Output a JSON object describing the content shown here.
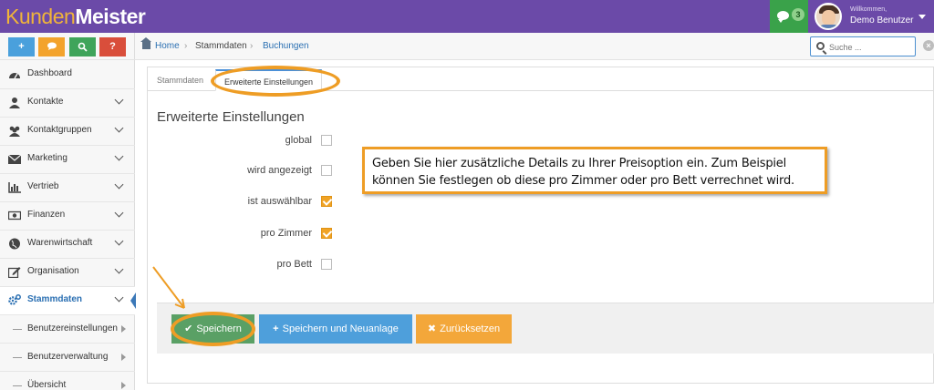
{
  "app": {
    "logo_part1": "Kunden",
    "logo_part2": "Meister",
    "message_count": "3",
    "welcome": "Willkommen,",
    "user": "Demo Benutzer"
  },
  "quick_buttons": [
    "+",
    "chat",
    "search",
    "?"
  ],
  "sidebar": {
    "items": [
      {
        "label": "Dashboard",
        "icon": "dashboard-icon"
      },
      {
        "label": "Kontakte",
        "icon": "user-icon"
      },
      {
        "label": "Kontaktgruppen",
        "icon": "group-icon"
      },
      {
        "label": "Marketing",
        "icon": "envelope-icon"
      },
      {
        "label": "Vertrieb",
        "icon": "bar-chart-icon"
      },
      {
        "label": "Finanzen",
        "icon": "money-icon"
      },
      {
        "label": "Warenwirtschaft",
        "icon": "globe-icon"
      },
      {
        "label": "Organisation",
        "icon": "edit-icon"
      },
      {
        "label": "Stammdaten",
        "icon": "gears-icon"
      }
    ],
    "subitems": [
      "Benutzereinstellungen",
      "Benutzerverwaltung",
      "Übersicht"
    ]
  },
  "breadcrumb": {
    "home": "Home",
    "level1": "Stammdaten",
    "level2": "Buchungen"
  },
  "search": {
    "placeholder": "Suche ..."
  },
  "tabs": {
    "tab1": "Stammdaten",
    "tab2": "Erweiterte Einstellungen"
  },
  "section_title": "Erweiterte Einstellungen",
  "fields": [
    {
      "label": "global",
      "checked": false
    },
    {
      "label": "wird angezeigt",
      "checked": false
    },
    {
      "label": "ist auswählbar",
      "checked": true
    },
    {
      "label": "pro Zimmer",
      "checked": true
    },
    {
      "label": "pro Bett",
      "checked": false
    }
  ],
  "callout": {
    "line1": "Geben Sie hier zusätzliche Details zu Ihrer Preisoption ein. Zum Beispiel",
    "line2": "können Sie festlegen ob diese pro Zimmer oder pro Bett verrechnet wird."
  },
  "buttons": {
    "save": "Speichern",
    "save_new": "Speichern und Neuanlage",
    "reset": "Zurücksetzen"
  },
  "colors": {
    "topbar": "#6b4aa8",
    "accent_orange": "#ee9d25",
    "save_green": "#5aa065",
    "new_blue": "#4e9fdb",
    "reset_orange": "#f3a73a"
  }
}
